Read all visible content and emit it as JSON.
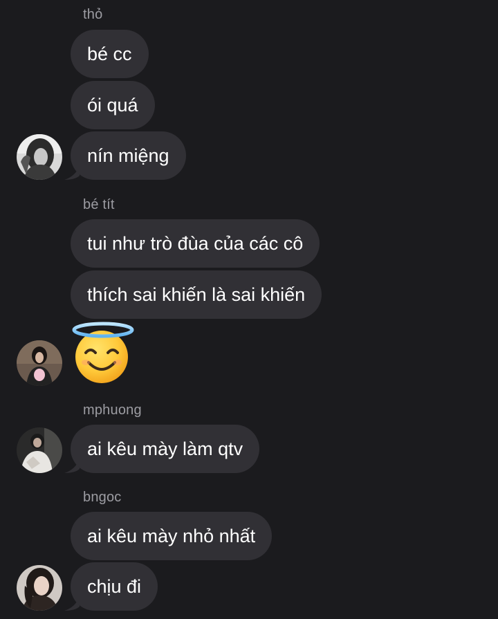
{
  "groups": [
    {
      "sender": "thỏ",
      "messages": [
        "bé cc",
        "ói quá",
        "nín miệng"
      ],
      "avatar_icon": "user-photo-avatar-tho"
    },
    {
      "sender": "bé tít",
      "messages": [
        "tui như trò đùa của các cô",
        "thích sai khiến là sai khiến"
      ],
      "emoji": "smiling-face-with-halo-emoji",
      "avatar_icon": "user-photo-avatar-be-tit"
    },
    {
      "sender": "mphuong",
      "messages": [
        "ai kêu mày làm qtv"
      ],
      "avatar_icon": "user-photo-avatar-mphuong"
    },
    {
      "sender": "bngoc",
      "messages": [
        "ai kêu mày nhỏ nhất",
        "chịu đi"
      ],
      "avatar_icon": "user-photo-avatar-bngoc"
    }
  ],
  "colors": {
    "background": "#1b1b1e",
    "bubble": "#313035",
    "sender_name": "#9d9da3",
    "text": "#ffffff"
  }
}
